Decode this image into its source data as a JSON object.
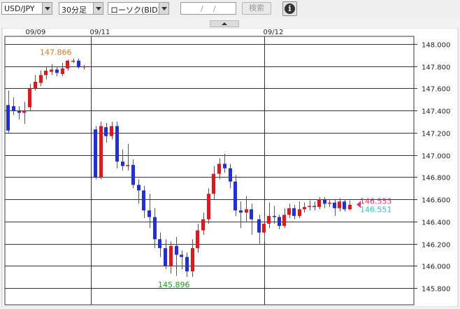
{
  "toolbar": {
    "currency_pair": "USD/JPY",
    "timeframe": "30分足",
    "chart_type": "ローソク(BID)",
    "date_sep1": "/",
    "date_sep2": "/",
    "search_label": "検索",
    "info_icon": "i"
  },
  "colors": {
    "up": "#e8141a",
    "down": "#1f2fe0",
    "high_label": "#e07a1a",
    "low_label": "#17a21e",
    "ask_marker": "#e0336e",
    "bid_marker": "#2fc0d8",
    "grid": "#333333"
  },
  "chart_data": {
    "type": "candlestick",
    "instrument": "USD/JPY",
    "x_labels": [
      "09/09",
      "09/11",
      "09/12"
    ],
    "y_ticks": [
      "148.000",
      "147.800",
      "147.600",
      "147.400",
      "147.200",
      "147.000",
      "146.800",
      "146.600",
      "146.400",
      "146.200",
      "146.000",
      "145.800"
    ],
    "ylim": [
      145.76,
      148.04
    ],
    "high_label": "147.866",
    "low_label": "145.896",
    "ask_label": "146.553",
    "bid_label": "146.551",
    "candles": [
      [
        147.45,
        147.22,
        147.58,
        147.2
      ],
      [
        147.44,
        147.4,
        147.52,
        147.36
      ],
      [
        147.4,
        147.38,
        147.44,
        147.32
      ],
      [
        147.38,
        147.4,
        147.48,
        147.28
      ],
      [
        147.43,
        147.6,
        147.64,
        147.4
      ],
      [
        147.6,
        147.66,
        147.72,
        147.58
      ],
      [
        147.65,
        147.72,
        147.76,
        147.62
      ],
      [
        147.72,
        147.76,
        147.8,
        147.68
      ],
      [
        147.75,
        147.77,
        147.82,
        147.72
      ],
      [
        147.77,
        147.74,
        147.79,
        147.71
      ],
      [
        147.73,
        147.78,
        147.83,
        147.71
      ],
      [
        147.78,
        147.85,
        147.86,
        147.76
      ],
      [
        147.84,
        147.85,
        147.87,
        147.83
      ],
      [
        147.85,
        147.79,
        147.87,
        147.78
      ],
      [
        147.79,
        147.8,
        147.81,
        147.77
      ],
      [
        147.23,
        146.8,
        147.26,
        146.78
      ],
      [
        146.8,
        147.26,
        147.3,
        146.78
      ],
      [
        147.25,
        147.17,
        147.29,
        147.11
      ],
      [
        147.17,
        147.26,
        147.3,
        147.14
      ],
      [
        147.26,
        146.94,
        147.3,
        146.88
      ],
      [
        146.94,
        146.9,
        147.05,
        146.86
      ],
      [
        146.9,
        146.91,
        147.1,
        146.86
      ],
      [
        146.91,
        146.73,
        146.96,
        146.7
      ],
      [
        146.73,
        146.68,
        146.78,
        146.56
      ],
      [
        146.68,
        146.5,
        146.72,
        146.43
      ],
      [
        146.5,
        146.44,
        146.65,
        146.34
      ],
      [
        146.44,
        146.24,
        146.52,
        146.16
      ],
      [
        146.24,
        146.16,
        146.3,
        146.08
      ],
      [
        146.16,
        146.0,
        146.24,
        145.97
      ],
      [
        146.0,
        146.18,
        146.22,
        145.93
      ],
      [
        146.18,
        146.1,
        146.26,
        145.91
      ],
      [
        146.1,
        146.08,
        146.14,
        145.97
      ],
      [
        146.08,
        145.95,
        146.12,
        145.9
      ],
      [
        145.95,
        146.16,
        146.24,
        145.9
      ],
      [
        146.16,
        146.32,
        146.38,
        146.12
      ],
      [
        146.32,
        146.42,
        146.48,
        146.28
      ],
      [
        146.42,
        146.65,
        146.7,
        146.38
      ],
      [
        146.65,
        146.83,
        146.9,
        146.6
      ],
      [
        146.83,
        146.92,
        146.97,
        146.78
      ],
      [
        146.92,
        146.88,
        147.01,
        146.84
      ],
      [
        146.88,
        146.76,
        146.92,
        146.7
      ],
      [
        146.76,
        146.5,
        146.82,
        146.45
      ],
      [
        146.5,
        146.48,
        146.58,
        146.34
      ],
      [
        146.48,
        146.51,
        146.63,
        146.4
      ],
      [
        146.51,
        146.42,
        146.56,
        146.28
      ],
      [
        146.42,
        146.3,
        146.46,
        146.2
      ],
      [
        146.3,
        146.38,
        146.44,
        146.22
      ],
      [
        146.38,
        146.45,
        146.57,
        146.34
      ],
      [
        146.45,
        146.44,
        146.54,
        146.38
      ],
      [
        146.44,
        146.36,
        146.46,
        146.33
      ],
      [
        146.36,
        146.46,
        146.52,
        146.34
      ],
      [
        146.46,
        146.52,
        146.56,
        146.43
      ],
      [
        146.52,
        146.45,
        146.55,
        146.42
      ],
      [
        146.45,
        146.51,
        146.58,
        146.43
      ],
      [
        146.51,
        146.53,
        146.57,
        146.48
      ],
      [
        146.53,
        146.54,
        146.59,
        146.5
      ],
      [
        146.54,
        146.53,
        146.58,
        146.5
      ],
      [
        146.53,
        146.6,
        146.62,
        146.51
      ],
      [
        146.6,
        146.56,
        146.62,
        146.52
      ],
      [
        146.56,
        146.57,
        146.6,
        146.53
      ],
      [
        146.57,
        146.52,
        146.6,
        146.45
      ],
      [
        146.52,
        146.58,
        146.61,
        146.49
      ],
      [
        146.58,
        146.51,
        146.6,
        146.49
      ],
      [
        146.51,
        146.55,
        146.59,
        146.5
      ]
    ]
  }
}
